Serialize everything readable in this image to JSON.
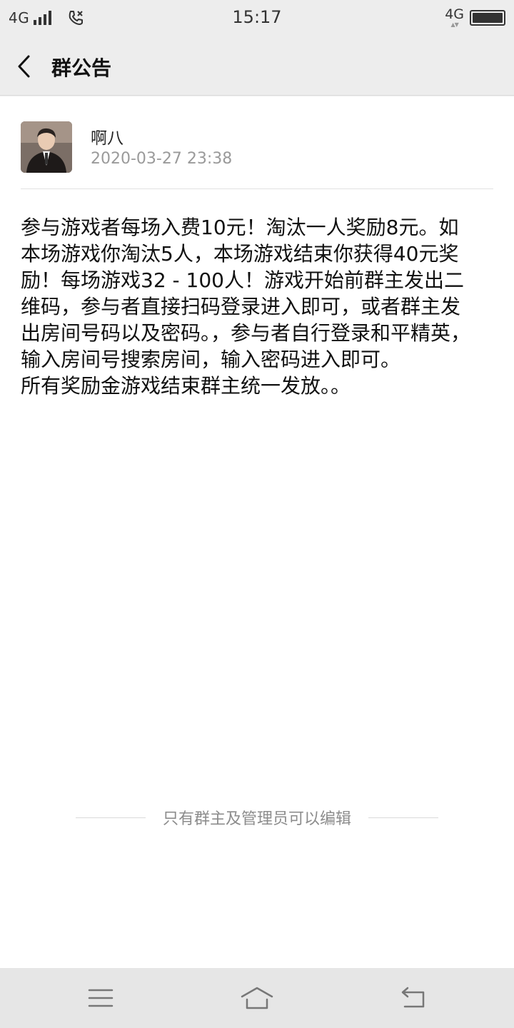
{
  "status_bar": {
    "network_left": "4G",
    "time": "15:17",
    "network_right": "4G",
    "icons": [
      "signal-icon",
      "call-icon",
      "battery-icon"
    ]
  },
  "header": {
    "title": "群公告",
    "back_icon": "back-chevron-icon"
  },
  "announcement": {
    "author": "啊八",
    "timestamp": "2020-03-27 23:38",
    "body": "参与游戏者每场入费10元！淘汰一人奖励8元。如本场游戏你淘汰5人，本场游戏结束你获得40元奖励！每场游戏32 - 100人！游戏开始前群主发出二维码，参与者直接扫码登录进入即可，或者群主发出房间号码以及密码。，参与者自行登录和平精英，输入房间号搜索房间，输入密码进入即可。\n所有奖励金游戏结束群主统一发放。。"
  },
  "edit_note": "只有群主及管理员可以编辑",
  "nav_bar": {
    "icons": [
      "menu-icon",
      "home-icon",
      "back-icon"
    ]
  },
  "colors": {
    "background": "#ededed",
    "content_background": "#ffffff",
    "secondary_text": "#9a9a9a"
  }
}
